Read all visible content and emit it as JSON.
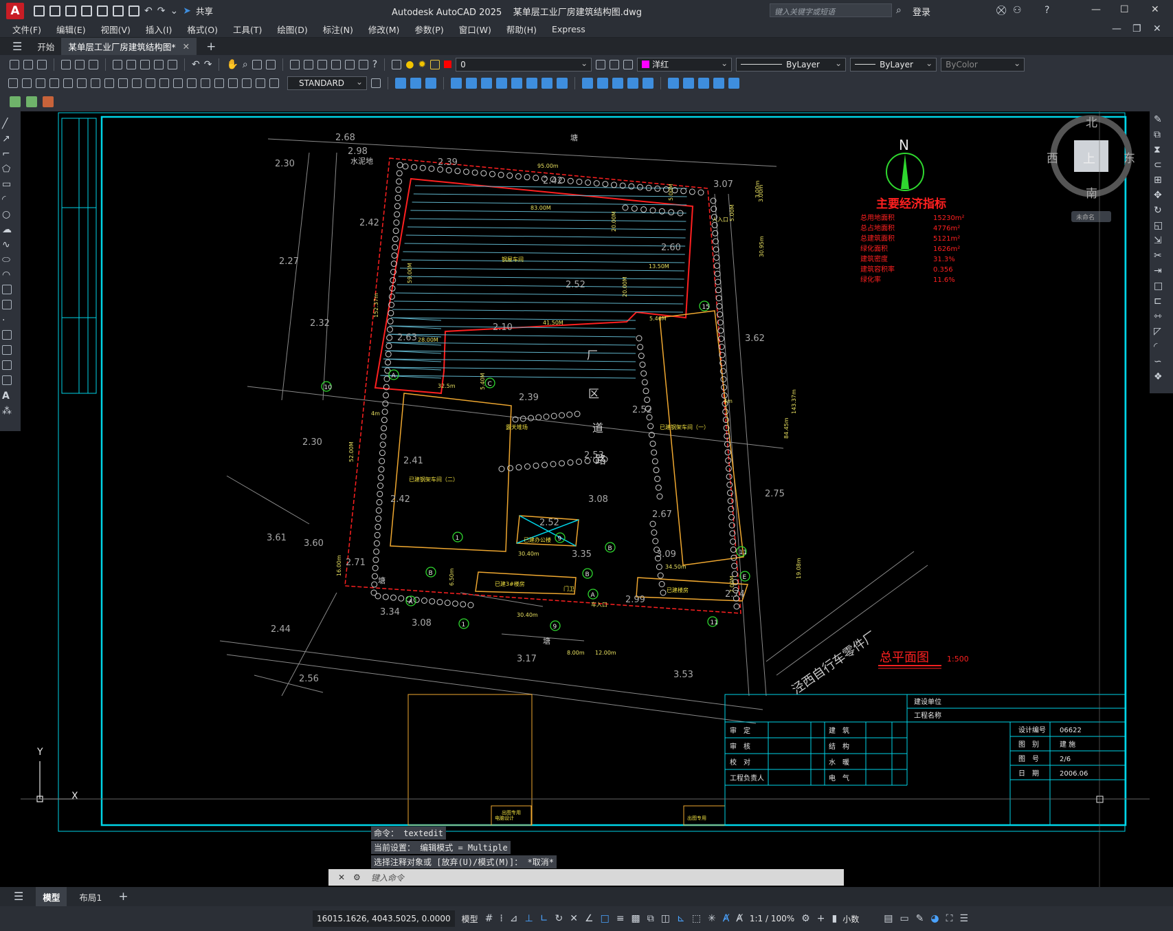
{
  "window": {
    "app_title": "Autodesk AutoCAD 2025",
    "file_name": "某单层工业厂房建筑结构图.dwg",
    "share_label": "共享",
    "search_placeholder": "键入关键字或短语",
    "login_label": "登录"
  },
  "menu": [
    "文件(F)",
    "编辑(E)",
    "视图(V)",
    "插入(I)",
    "格式(O)",
    "工具(T)",
    "绘图(D)",
    "标注(N)",
    "修改(M)",
    "参数(P)",
    "窗口(W)",
    "帮助(H)",
    "Express"
  ],
  "tabs": {
    "start": "开始",
    "drawing": "某单层工业厂房建筑结构图*"
  },
  "toolbar": {
    "layer_value": "0",
    "color_value": "洋红",
    "linetype_value": "ByLayer",
    "lineweight_value": "ByLayer",
    "plotstyle_value": "ByColor",
    "textstyle_value": "STANDARD"
  },
  "viewcube": {
    "north": "北",
    "south": "南",
    "east": "东",
    "west": "西",
    "top": "上",
    "wcs": "未命名"
  },
  "drawing": {
    "north_label": "N",
    "indicator_title": "主要经济指标",
    "indicators": [
      {
        "label": "总用地面积",
        "value": "15230m²"
      },
      {
        "label": "总占地面积",
        "value": "4776m²"
      },
      {
        "label": "总建筑面积",
        "value": "5121m²"
      },
      {
        "label": "绿化面积",
        "value": "1626m²"
      },
      {
        "label": "建筑密度",
        "value": "31.3%"
      },
      {
        "label": "建筑容积率",
        "value": "0.356"
      },
      {
        "label": "绿化率",
        "value": "11.6%"
      }
    ],
    "plan_title": "总平面图",
    "plan_scale": "1:500",
    "road_name": "泾西自行车零件厂",
    "road_chars": [
      "厂",
      "区",
      "道",
      "路"
    ],
    "buildings": [
      "钢屋车间",
      "已建钢架车间（一）",
      "已建钢架车间（二）",
      "露天堆场",
      "已建办公楼",
      "已建3#楼房",
      "已建楼房",
      "门卫"
    ],
    "labels": {
      "cement": "水泥地",
      "pond": "塘",
      "entry_person": "人入口",
      "entry_car": "车入口"
    },
    "elevations": [
      "2.68",
      "2.98",
      "2.30",
      "2.39",
      "2.42",
      "3.07",
      "2.27",
      "2.42",
      "2.32",
      "2.10",
      "2.63",
      "2.52",
      "2.60",
      "3.62",
      "2.39",
      "2.52",
      "2.30",
      "2.41",
      "2.42",
      "2.53",
      "3.08",
      "2.75",
      "2.52",
      "2.67",
      "3.09",
      "3.61",
      "3.60",
      "2.71",
      "3.35",
      "3.34",
      "3.08",
      "2.99",
      "2.74",
      "2.44",
      "3.17",
      "2.56",
      "3.53"
    ],
    "dimensions": [
      "95.00m",
      "83.00M",
      "20.00M",
      "13.50M",
      "20.00M",
      "41.50M",
      "28.00M",
      "59.00M",
      "152.37m",
      "32.5m",
      "5.40M",
      "52.00M",
      "30.40m",
      "30.40m",
      "8.00m",
      "12.00m",
      "34.50m",
      "3.00m",
      "30.95m",
      "143.37m",
      "84.45m",
      "19.08m",
      "16.00m",
      "6.50m",
      "4m",
      "4m",
      "5.46M",
      "5.00M",
      "7.00M",
      "5.00M",
      "3.00m"
    ],
    "axes": [
      "A",
      "B",
      "C",
      "1",
      "9",
      "10",
      "11",
      "15",
      "E",
      "A",
      "B",
      "1",
      "9",
      "11",
      "A",
      "B"
    ]
  },
  "title_block": {
    "unit_label": "建设单位",
    "project_label": "工程名称",
    "rows": [
      {
        "l": "审　定",
        "m": "建　筑"
      },
      {
        "l": "审　核",
        "m": "结　构"
      },
      {
        "l": "校　对",
        "m": "水　暖"
      },
      {
        "l": "工程负责人",
        "m": "电　气"
      }
    ],
    "info": [
      {
        "k": "设计编号",
        "v": "06622"
      },
      {
        "k": "图　别",
        "v": "建 施"
      },
      {
        "k": "图　号",
        "v": "2/6"
      },
      {
        "k": "日　期",
        "v": "2006.06"
      }
    ],
    "stamp_left": "电脑设计",
    "stamp_mid": "出图专用",
    "stamp_right": "出图专用"
  },
  "command": {
    "history": [
      "命令： textedit",
      "当前设置： 编辑模式 = Multiple",
      "选择注释对象或 [放弃(U)/模式(M)]： *取消*"
    ],
    "placeholder": "键入命令"
  },
  "layout_tabs": {
    "model": "模型",
    "layout1": "布局1"
  },
  "status": {
    "coords": "16015.1626, 4043.5025, 0.0000",
    "space": "模型",
    "scale": "1:1 / 100%",
    "units": "小数"
  },
  "ucs": {
    "y": "Y",
    "x": "X"
  },
  "colors": {
    "accent": "#c81d25",
    "cyan": "#00e5ff",
    "red": "#ff2020",
    "yellow": "#ffcc00",
    "green": "#2fd82f",
    "magenta": "#ff00ff"
  }
}
